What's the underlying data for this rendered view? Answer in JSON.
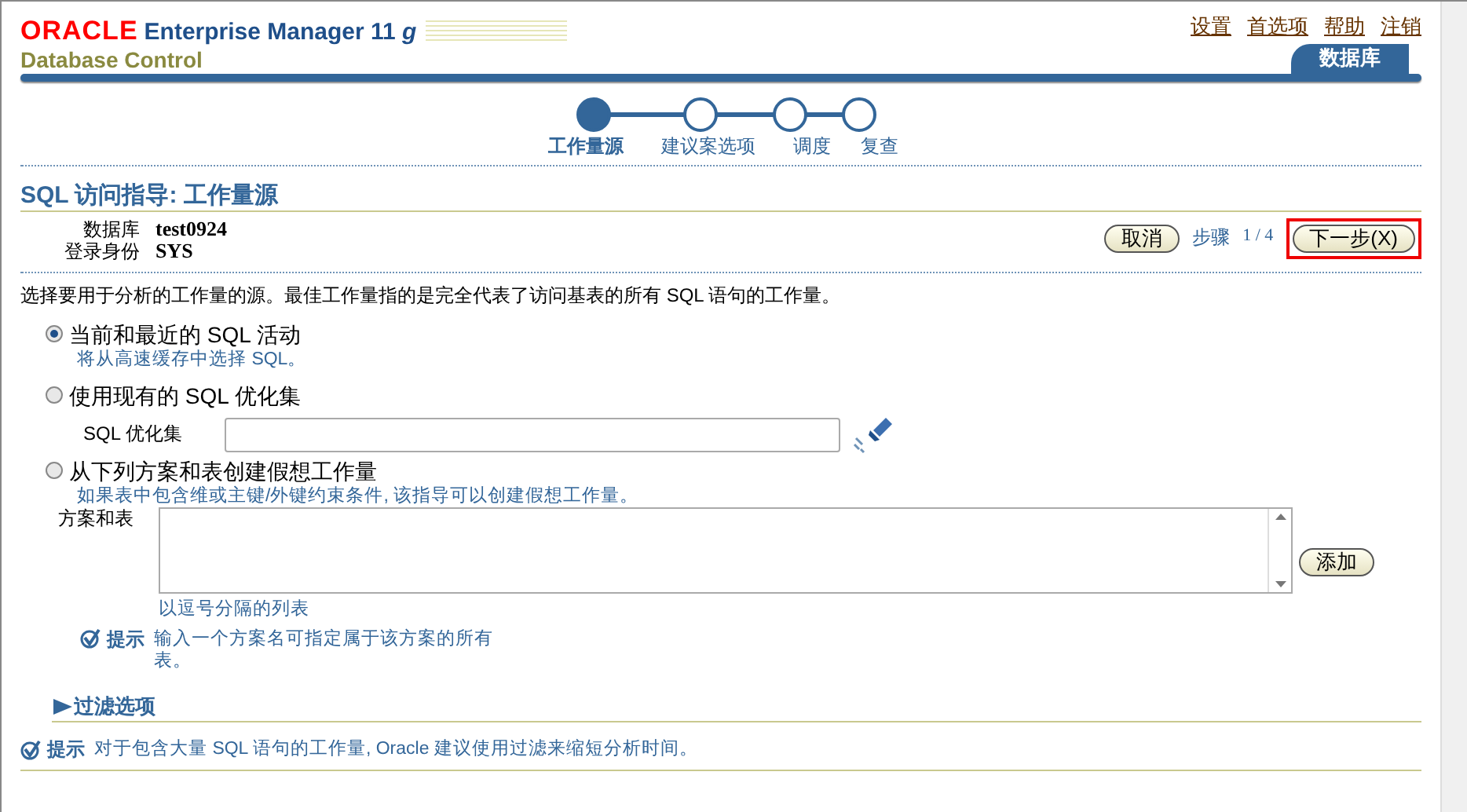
{
  "header": {
    "brand": "ORACLE",
    "product": "Enterprise Manager 11",
    "product_suffix": "g",
    "subtitle": "Database Control",
    "global_links": [
      "设置",
      "首选项",
      "帮助",
      "注销"
    ],
    "tabs": [
      {
        "label": "数据库",
        "selected": true
      }
    ]
  },
  "train": [
    {
      "label": "工作量源",
      "selected": true
    },
    {
      "label": "建议案选项",
      "selected": false
    },
    {
      "label": "调度",
      "selected": false
    },
    {
      "label": "复查",
      "selected": false
    }
  ],
  "page_title": "SQL 访问指导: 工作量源",
  "info": [
    {
      "label": "数据库",
      "value": "test0924"
    },
    {
      "label": "登录身份",
      "value": "SYS"
    }
  ],
  "actions": {
    "cancel": "取消",
    "step_label": "步骤",
    "step": "1 / 4",
    "next": "下一步(X)",
    "next_highlighted": true
  },
  "description": "选择要用于分析的工作量的源。最佳工作量指的是完全代表了访问基表的所有 SQL 语句的工作量。",
  "options": [
    {
      "kind": "plain",
      "label": "当前和最近的 SQL 活动",
      "selected": true,
      "hint": "将从高速缓存中选择 SQL。"
    },
    {
      "kind": "search",
      "label": "使用现有的 SQL 优化集",
      "selected": false,
      "field_label": "SQL 优化集"
    },
    {
      "kind": "schema",
      "label": "从下列方案和表创建假想工作量",
      "selected": false,
      "hint": "如果表中包含维或主键/外键约束条件, 该指导可以创建假想工作量。",
      "field_label": "方案和表",
      "button": "添加",
      "field_help": "以逗号分隔的列表",
      "tip_label": "提示",
      "tip": "输入一个方案名可指定属于该方案的所有表。"
    }
  ],
  "filter": {
    "label": "过滤选项",
    "expanded": false
  },
  "bottom_tip": {
    "label": "提示",
    "text": "对于包含大量 SQL 语句的工作量, Oracle 建议使用过滤来缩短分析时间。"
  }
}
